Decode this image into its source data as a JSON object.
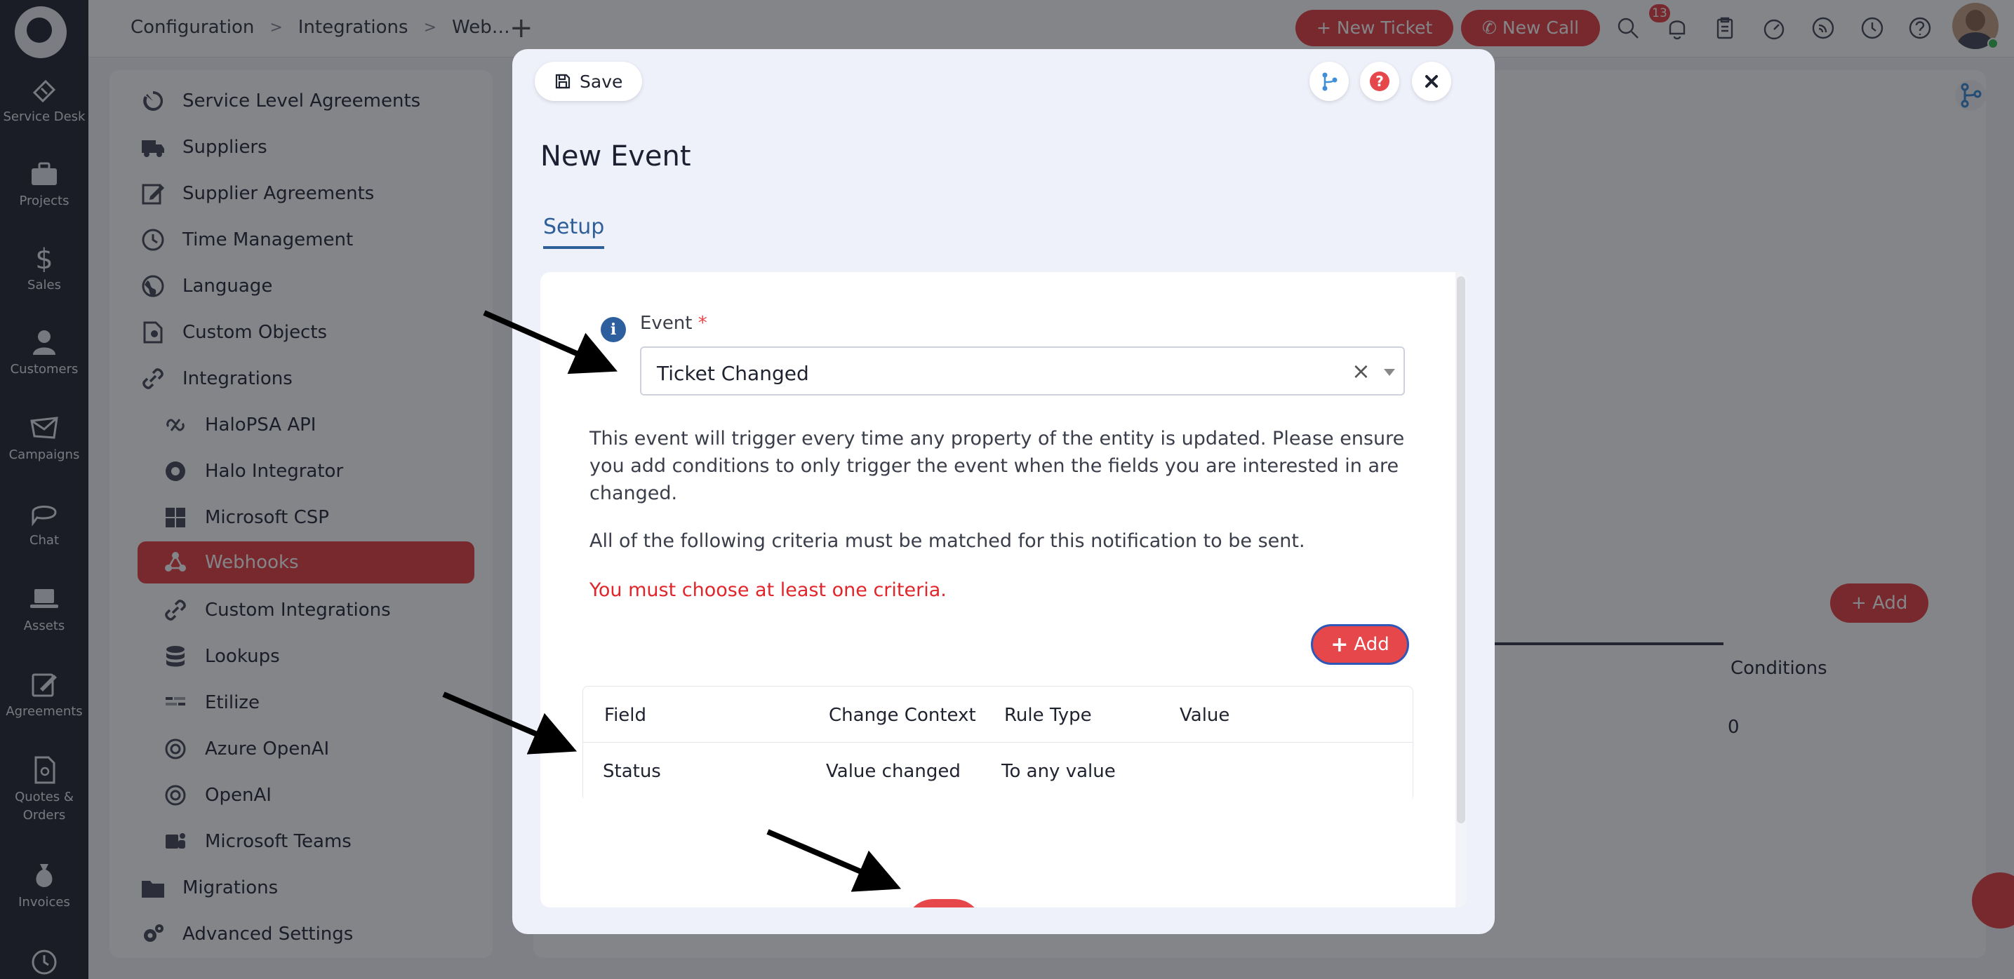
{
  "rail": {
    "items": [
      {
        "label": "Service Desk",
        "icon": "ticket-icon"
      },
      {
        "label": "Projects",
        "icon": "briefcase-icon"
      },
      {
        "label": "Sales",
        "icon": "dollar-icon"
      },
      {
        "label": "Customers",
        "icon": "person-icon"
      },
      {
        "label": "Campaigns",
        "icon": "envelope-icon"
      },
      {
        "label": "Chat",
        "icon": "chat-icon"
      },
      {
        "label": "Assets",
        "icon": "laptop-icon"
      },
      {
        "label": "Agreements",
        "icon": "pen-icon"
      },
      {
        "label": "Quotes &",
        "label2": "Orders",
        "icon": "quote-icon"
      },
      {
        "label": "Invoices",
        "icon": "money-bag-icon"
      }
    ]
  },
  "topbar": {
    "breadcrumb": [
      "Configuration",
      "Integrations",
      "Web…"
    ],
    "new_ticket": "New Ticket",
    "new_call": "New Call",
    "notifications_count": "13"
  },
  "settings": {
    "items": [
      {
        "label": "Service Level Agreements",
        "icon": "sla-icon"
      },
      {
        "label": "Suppliers",
        "icon": "truck-icon"
      },
      {
        "label": "Supplier Agreements",
        "icon": "edit-icon"
      },
      {
        "label": "Time Management",
        "icon": "clock-icon"
      },
      {
        "label": "Language",
        "icon": "globe-icon"
      },
      {
        "label": "Custom Objects",
        "icon": "custom-object-icon"
      },
      {
        "label": "Integrations",
        "icon": "link-icon"
      },
      {
        "label": "HaloPSA API",
        "icon": "api-icon",
        "sub": true
      },
      {
        "label": "Halo Integrator",
        "icon": "circle-icon",
        "sub": true
      },
      {
        "label": "Microsoft CSP",
        "icon": "windows-icon",
        "sub": true
      },
      {
        "label": "Webhooks",
        "icon": "webhook-icon",
        "sub": true,
        "active": true
      },
      {
        "label": "Custom Integrations",
        "icon": "link-icon",
        "sub": true
      },
      {
        "label": "Lookups",
        "icon": "database-icon",
        "sub": true
      },
      {
        "label": "Etilize",
        "icon": "etilize-icon",
        "sub": true
      },
      {
        "label": "Azure OpenAI",
        "icon": "openai-icon",
        "sub": true
      },
      {
        "label": "OpenAI",
        "icon": "openai-icon",
        "sub": true
      },
      {
        "label": "Microsoft Teams",
        "icon": "teams-icon",
        "sub": true
      },
      {
        "label": "Migrations",
        "icon": "folder-icon"
      },
      {
        "label": "Advanced Settings",
        "icon": "gears-icon"
      }
    ]
  },
  "background": {
    "add_label": "Add",
    "conditions_header": "Conditions",
    "conditions_value": "0"
  },
  "modal": {
    "save_label": "Save",
    "title": "New Event",
    "tab_setup": "Setup",
    "event_label": "Event",
    "required_mark": "*",
    "event_value": "Ticket Changed",
    "description": "This event will trigger every time any property of the entity is updated. Please ensure you add conditions to only trigger the event when the fields you are interested in are changed.",
    "criteria_text": "All of the following criteria must be matched for this notification to be sent.",
    "error_text": "You must choose at least one criteria.",
    "add_label": "Add",
    "table": {
      "headers": [
        "Field",
        "Change Context",
        "Rule Type",
        "Value"
      ],
      "rows": [
        [
          "Status",
          "Value changed",
          "To any value",
          ""
        ]
      ]
    }
  },
  "colors": {
    "accent": "#e5474b",
    "rail_bg": "#2a2f3b",
    "link_blue": "#2f5f98",
    "error": "#e0262b"
  }
}
